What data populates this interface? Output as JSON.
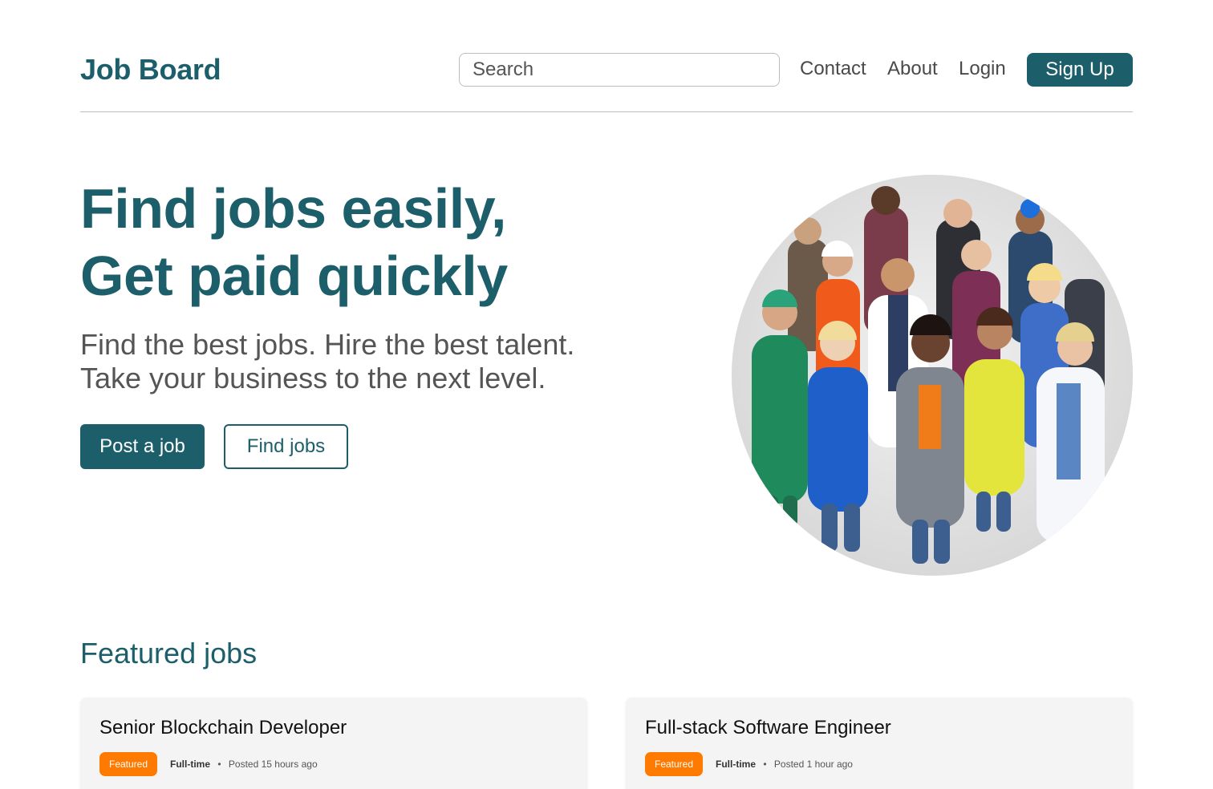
{
  "header": {
    "brand": "Job Board",
    "search_placeholder": "Search",
    "nav": {
      "contact": "Contact",
      "about": "About",
      "login": "Login",
      "signup": "Sign Up"
    }
  },
  "hero": {
    "title_line1": "Find jobs easily,",
    "title_line2": "Get paid quickly",
    "subtitle_line1": "Find the best jobs. Hire the best talent.",
    "subtitle_line2": "Take your business to the next level.",
    "primary_button": "Post a job",
    "secondary_button": "Find jobs"
  },
  "featured": {
    "title": "Featured jobs",
    "jobs": [
      {
        "title": "Senior Blockchain Developer",
        "badge": "Featured",
        "type": "Full-time",
        "separator": "•",
        "posted": "Posted 15 hours ago"
      },
      {
        "title": "Full-stack Software Engineer",
        "badge": "Featured",
        "type": "Full-time",
        "separator": "•",
        "posted": "Posted 1 hour ago"
      }
    ]
  },
  "colors": {
    "brand": "#1c5f6a",
    "badge": "#ff7a00",
    "card_bg": "#f4f4f4"
  }
}
